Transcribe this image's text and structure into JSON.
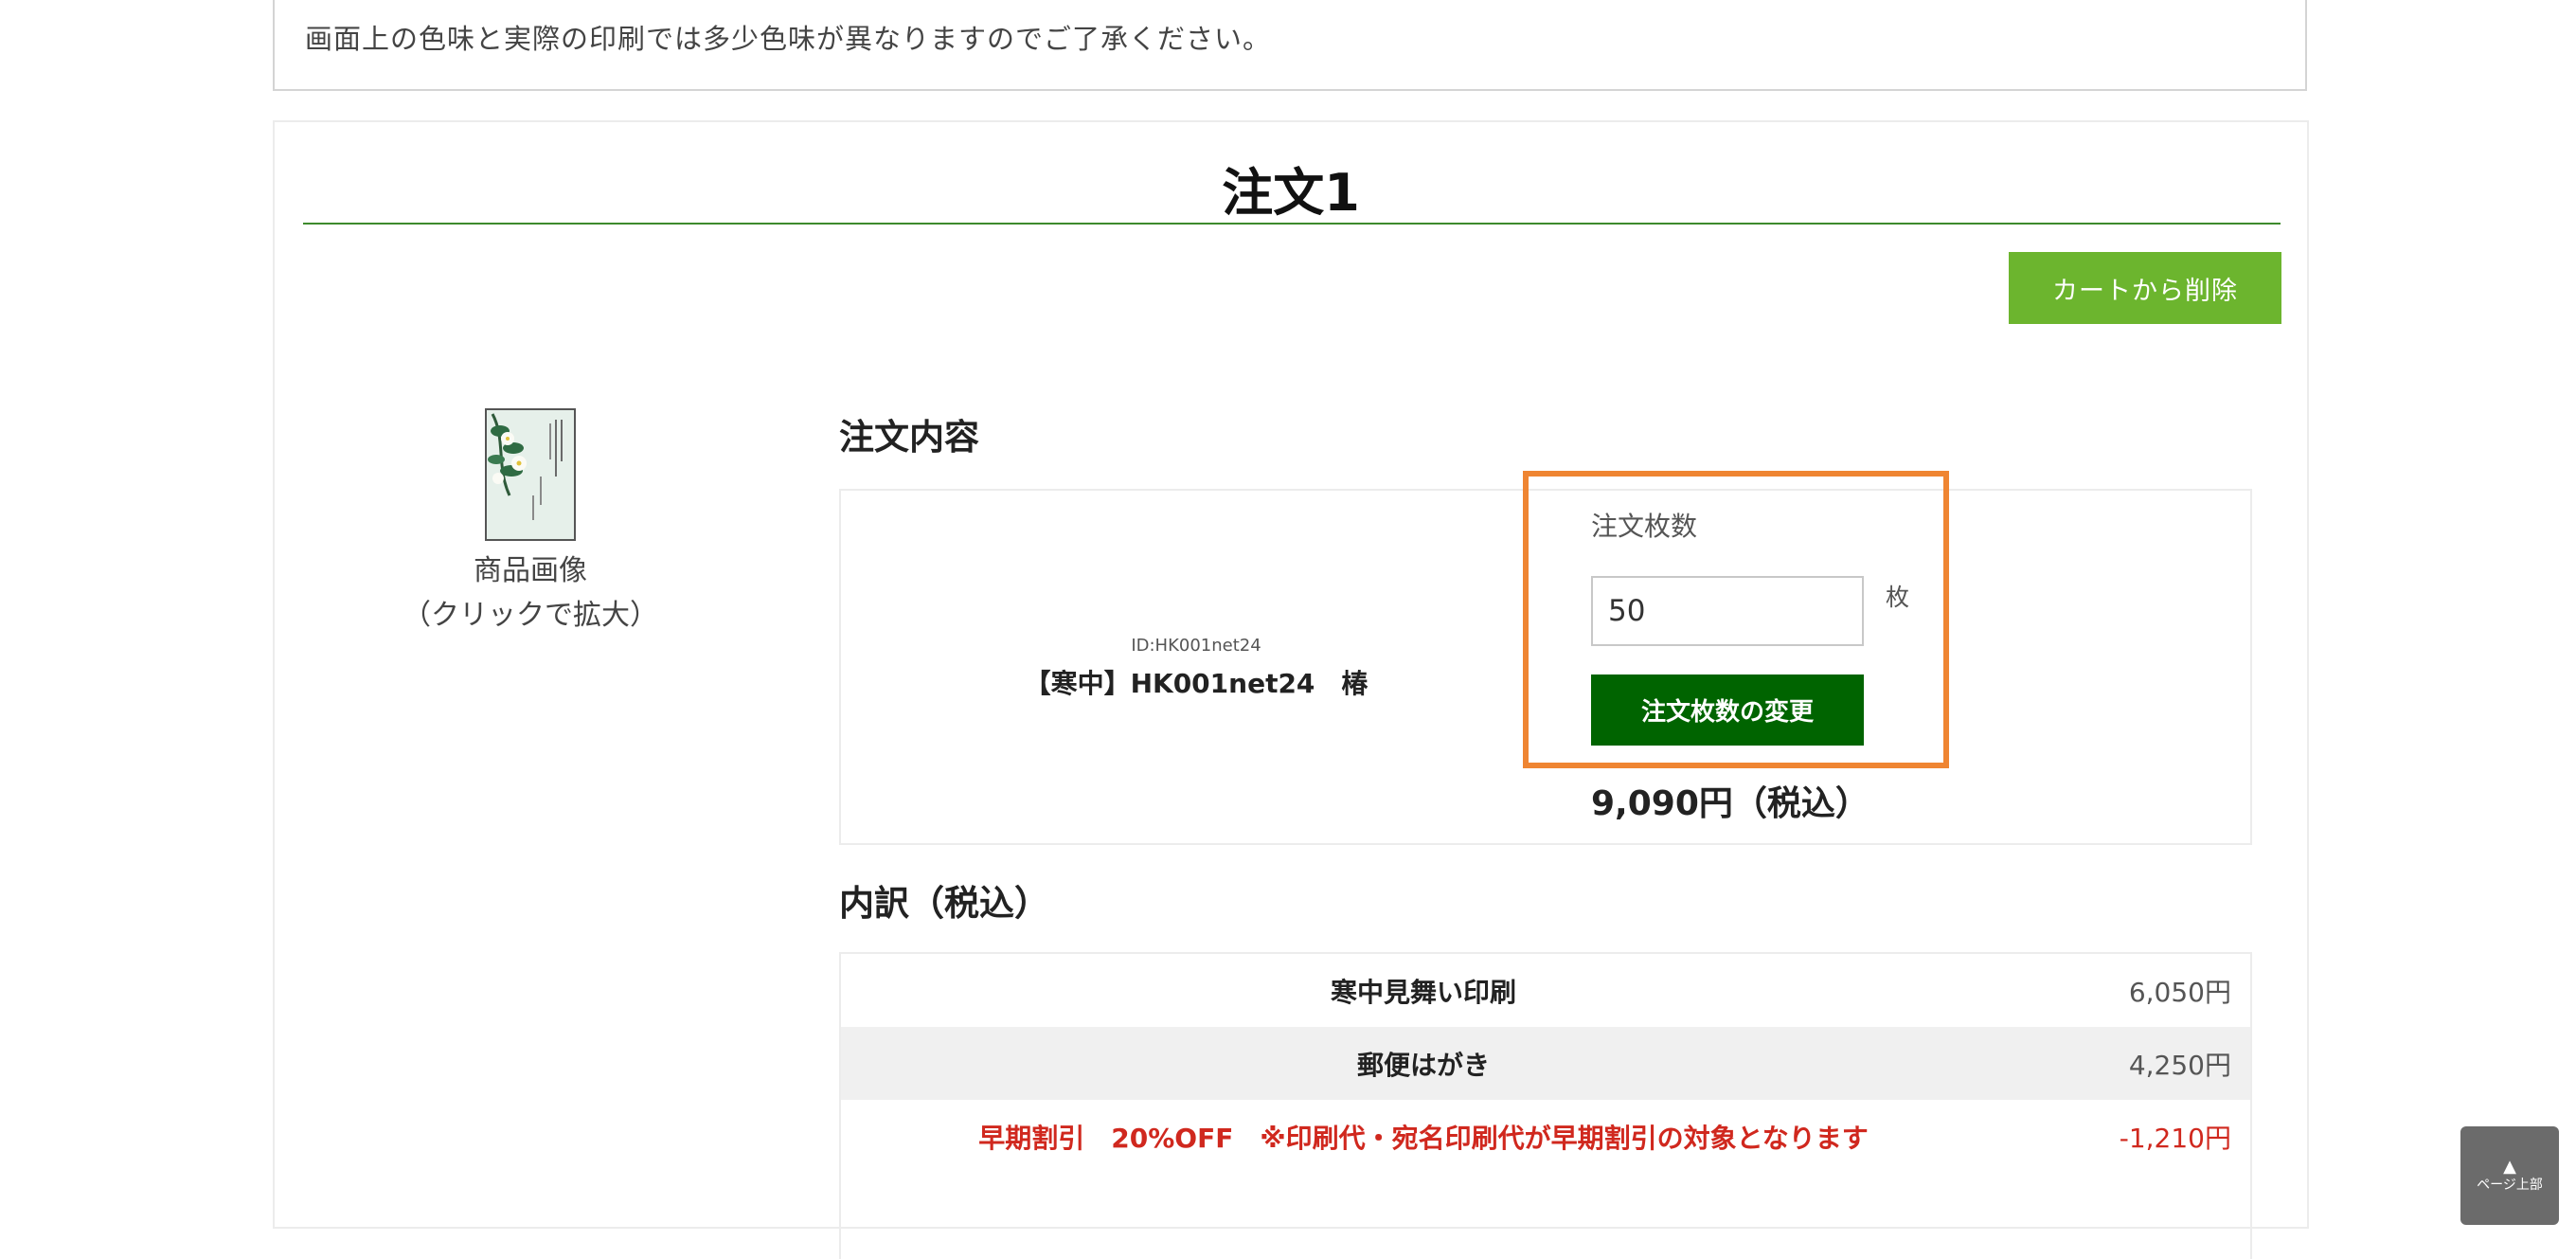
{
  "notice": {
    "text": "画面上の色味と実際の印刷では多少色味が異なりますのでご了承ください。"
  },
  "order": {
    "title": "注文1",
    "remove_button_label": "カートから削除",
    "image_caption_line1": "商品画像",
    "image_caption_line2": "（クリックで拡大）",
    "details_heading": "注文内容",
    "product_id": "ID:HK001net24",
    "product_name": "【寒中】HK001net24　椿",
    "quantity_label": "注文枚数",
    "quantity_value": "50",
    "quantity_unit": "枚",
    "change_quantity_button_label": "注文枚数の変更",
    "total_price": "9,090円（税込）",
    "breakdown_heading": "内訳（税込）",
    "breakdown": [
      {
        "label": "寒中見舞い印刷",
        "value": "6,050円"
      },
      {
        "label": "郵便はがき",
        "value": "4,250円"
      },
      {
        "label": "早期割引　20%OFF　※印刷代・宛名印刷代が早期割引の対象となります",
        "value": "-1,210円"
      }
    ]
  },
  "page_top": {
    "arrow": "▲",
    "label": "ページ上部"
  },
  "colors": {
    "rule_green": "#3d8a2c",
    "remove_button_bg": "#6cb52e",
    "change_button_bg": "#006400",
    "highlight_orange": "#ef8532",
    "discount_red": "#d0281e",
    "page_top_bg": "#6b6b6b"
  }
}
